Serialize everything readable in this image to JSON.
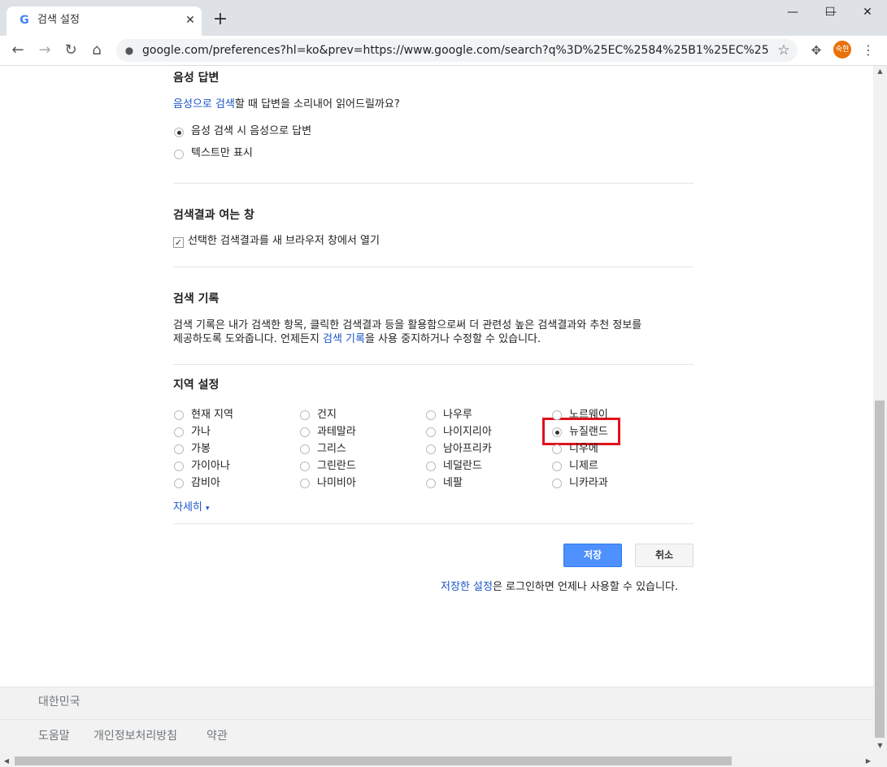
{
  "tab": {
    "title": "검색 설정",
    "favicon": "google-g-icon",
    "close": "✕",
    "new_tab": "+"
  },
  "window": {
    "minimize": "—",
    "maximize": "☐",
    "close": "✕"
  },
  "toolbar": {
    "back": "←",
    "forward": "→",
    "reload": "↻",
    "home": "⌂",
    "url": "google.com/preferences?hl=ko&prev=https://www.google.com/search?q%3D%25EC%2584%25B1%25EC%259D%25B8...",
    "lock": "🔒",
    "star": "☆",
    "extensions": "✥",
    "profile": "숙현",
    "menu": "⋮"
  },
  "voice": {
    "heading": "음성 답변",
    "desc_link": "음성으로 검색",
    "desc_rest": "할 때 답변을 소리내어 읽어드릴까요?",
    "options": [
      "음성 검색 시 음성으로 답변",
      "텍스트만 표시"
    ],
    "selected": 0
  },
  "results_window": {
    "heading": "검색결과 여는 창",
    "checkbox_label": "선택한 검색결과를 새 브라우저 창에서 열기",
    "checked": true
  },
  "history": {
    "heading": "검색 기록",
    "line1": "검색 기록은 내가 검색한 항목, 클릭한 검색결과 등을 활용함으로써 더 관련성 높은 검색결과와 추천 정보를",
    "line2_pre": "제공하도록 도와줍니다. 언제든지 ",
    "line2_link": "검색 기록",
    "line2_post": "을 사용 중지하거나 수정할 수 있습니다."
  },
  "region": {
    "heading": "지역 설정",
    "columns": [
      [
        "현재 지역",
        "가나",
        "가봉",
        "가이아나",
        "감비아"
      ],
      [
        "건지",
        "과테말라",
        "그리스",
        "그린란드",
        "나미비아"
      ],
      [
        "나우루",
        "나이지리아",
        "남아프리카",
        "네덜란드",
        "네팔"
      ],
      [
        "노르웨이",
        "뉴질랜드",
        "니우에",
        "니제르",
        "니카라과"
      ]
    ],
    "selected": "뉴질랜드",
    "more": "자세히",
    "more_arrow": "▾"
  },
  "actions": {
    "save": "저장",
    "cancel": "취소",
    "note_link": "저장한 설정",
    "note_rest": "은 로그인하면 언제나 사용할 수 있습니다."
  },
  "footer": {
    "country": "대한민국",
    "links": [
      "도움말",
      "개인정보처리방침",
      "약관"
    ]
  }
}
